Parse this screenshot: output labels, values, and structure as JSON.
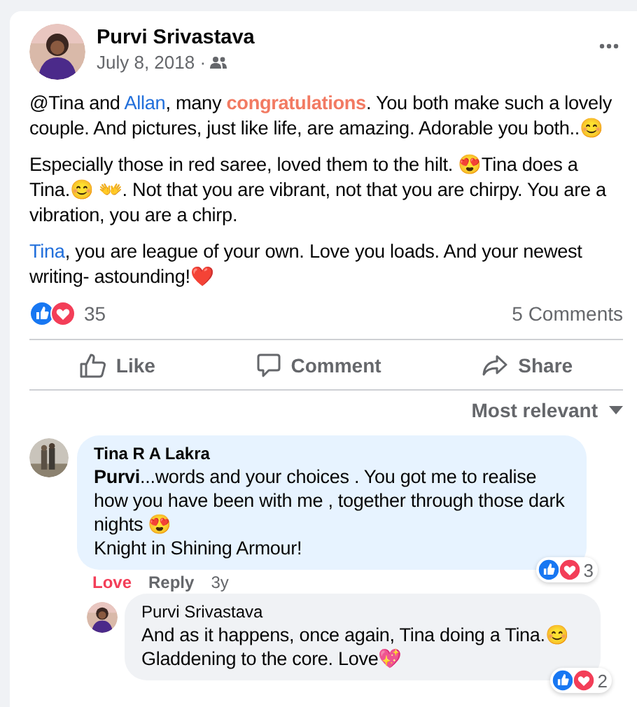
{
  "post": {
    "author": "Purvi Srivastava",
    "date": "July 8, 2018 ·",
    "paragraphs": [
      [
        {
          "kind": "text",
          "text": "@Tina and "
        },
        {
          "kind": "mention",
          "text": "Allan"
        },
        {
          "kind": "text",
          "text": ", many "
        },
        {
          "kind": "highlight",
          "text": "congratulations"
        },
        {
          "kind": "text",
          "text": ". You both make such a lovely couple. And pictures, just like life, are amazing. Adorable you both..😊"
        }
      ],
      [
        {
          "kind": "text",
          "text": "Especially those in red saree, loved them to the hilt. 😍Tina does a Tina.😊 👐. Not that you are vibrant, not that you are chirpy.  You are a vibration, you are a chirp."
        }
      ],
      [
        {
          "kind": "mention",
          "text": "Tina"
        },
        {
          "kind": "text",
          "text": ", you are league of your own. Love you loads. And your newest writing- astounding!❤️"
        }
      ]
    ],
    "reaction_count": "35",
    "comments_count": "5 Comments",
    "actions": [
      "Like",
      "Comment",
      "Share"
    ]
  },
  "sort": "Most relevant",
  "comments": [
    {
      "author": "Tina R A Lakra",
      "lead": "Purvi",
      "text": "...words and your choices . You got me to realise how you have been with me , together through those dark nights 😍\nKnight in Shining Armour!",
      "reacted": true,
      "reaction": "Love",
      "reply": "Reply",
      "age": "3y",
      "reaction_count": "3",
      "replies": [
        {
          "author": "Purvi Srivastava",
          "text": "And as it happens, once again, Tina doing a Tina.😊\nGladdening to the core. Love💖",
          "reaction_count": "2"
        }
      ]
    }
  ]
}
